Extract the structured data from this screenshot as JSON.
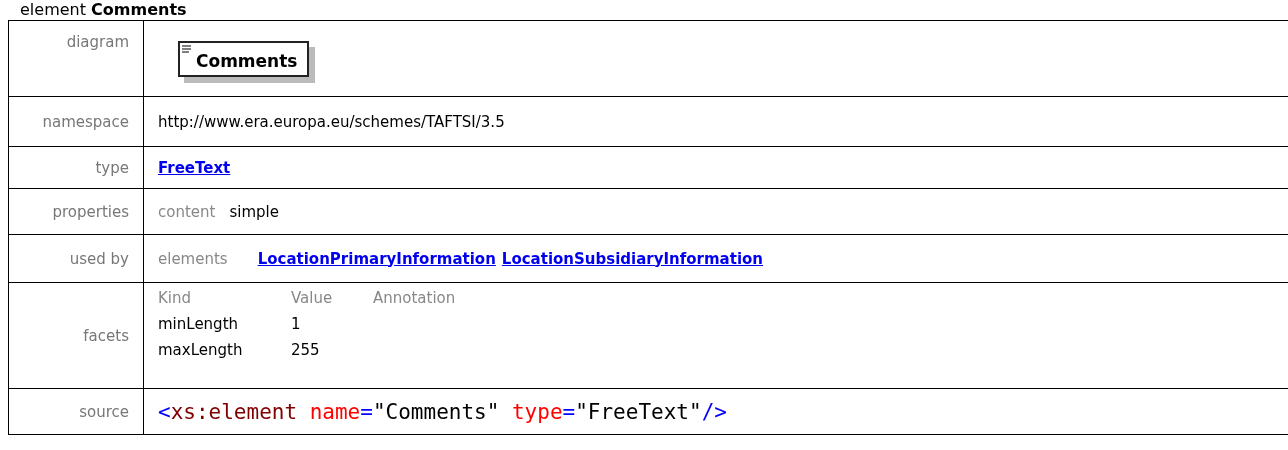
{
  "heading": "element **Comments**",
  "rows": [
    {
      "label": "diagram",
      "kind": "diagram",
      "node": "Comments"
    },
    {
      "label": "namespace",
      "kind": "text",
      "value": "http://www.era.europa.eu/schemes/TAFTSI/3.5"
    },
    {
      "label": "type",
      "kind": "links",
      "links": [
        "FreeText"
      ]
    },
    {
      "label": "properties",
      "kind": "pair",
      "key": "content",
      "value": "simple"
    },
    {
      "label": "used by",
      "kind": "pairlinks",
      "key": "elements",
      "links": [
        "LocationPrimaryInformation",
        "LocationSubsidiaryInformation"
      ]
    },
    {
      "label": "facets",
      "kind": "facets",
      "columns": [
        "Kind",
        "Value",
        "Annotation"
      ],
      "items": [
        [
          "minLength",
          "1"
        ],
        [
          "maxLength",
          "255"
        ]
      ]
    },
    {
      "label": "source",
      "kind": "source",
      "tokens": [
        {
          "kind": "punct",
          "text": "<"
        },
        {
          "kind": "tag",
          "text": "xs:element"
        },
        {
          "kind": "attr",
          "text": "name"
        },
        {
          "kind": "punct",
          "text": "="
        },
        {
          "kind": "value",
          "text": "\"Comments\""
        },
        {
          "kind": "attr",
          "text": "type"
        },
        {
          "kind": "punct",
          "text": "="
        },
        {
          "kind": "value",
          "text": "\"FreeText\""
        },
        {
          "kind": "punct",
          "text": "/>"
        }
      ]
    }
  ]
}
